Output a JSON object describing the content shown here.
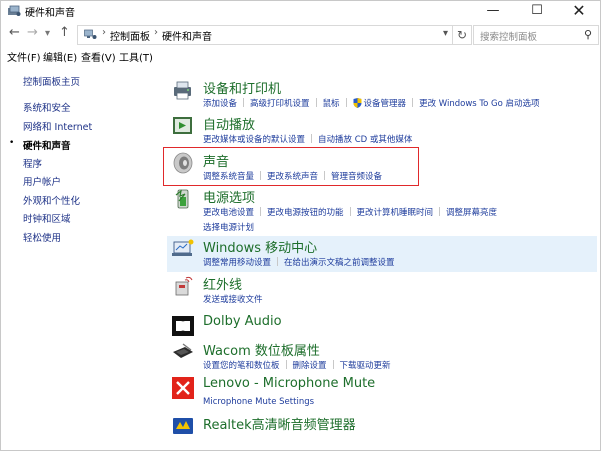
{
  "window": {
    "title": "硬件和声音",
    "minimize": "—",
    "maximize": "☐",
    "close": "✕"
  },
  "nav": {
    "back": "←",
    "forward": "→",
    "dropdown": "▾",
    "up": "↑",
    "breadcrumbs": [
      "控制面板",
      "硬件和声音"
    ],
    "refresh": "↻",
    "search_placeholder": "搜索控制面板"
  },
  "menu": [
    "文件(F)",
    "编辑(E)",
    "查看(V)",
    "工具(T)"
  ],
  "sidebar": {
    "items": [
      {
        "label": "控制面板主页"
      },
      {
        "label": "系统和安全"
      },
      {
        "label": "网络和 Internet"
      },
      {
        "label": "硬件和声音",
        "active": true
      },
      {
        "label": "程序"
      },
      {
        "label": "用户帐户"
      },
      {
        "label": "外观和个性化"
      },
      {
        "label": "时钟和区域"
      },
      {
        "label": "轻松使用"
      }
    ],
    "bullet": "•"
  },
  "categories": [
    {
      "title": "设备和打印机",
      "icon": "printer-icon",
      "links": [
        "添加设备",
        "高级打印机设置",
        "鼠标",
        "设备管理器",
        "更改 Windows To Go 启动选项"
      ]
    },
    {
      "title": "自动播放",
      "icon": "autoplay-icon",
      "links": [
        "更改媒体或设备的默认设置",
        "自动播放 CD 或其他媒体"
      ]
    },
    {
      "title": "声音",
      "icon": "speaker-icon",
      "links": [
        "调整系统音量",
        "更改系统声音",
        "管理音频设备"
      ]
    },
    {
      "title": "电源选项",
      "icon": "power-icon",
      "links": [
        "更改电池设置",
        "更改电源按钮的功能",
        "更改计算机睡眠时间",
        "调整屏幕亮度",
        "选择电源计划"
      ]
    },
    {
      "title": "Windows 移动中心",
      "icon": "mobility-center-icon",
      "links": [
        "调整常用移动设置",
        "在给出演示文稿之前调整设置"
      ]
    },
    {
      "title": "红外线",
      "icon": "infrared-icon",
      "links": [
        "发送或接收文件"
      ]
    },
    {
      "title": "Dolby Audio",
      "icon": "dolby-icon",
      "links": []
    },
    {
      "title": "Wacom 数位板属性",
      "icon": "wacom-tablet-icon",
      "links": [
        "设置您的笔和数位板",
        "删除设置",
        "下载驱动更新"
      ]
    },
    {
      "title": "Lenovo - Microphone Mute",
      "icon": "microphone-mute-icon",
      "links": [
        "Microphone Mute Settings"
      ]
    },
    {
      "title": "Realtek高清晰音频管理器",
      "icon": "realtek-audio-icon",
      "links": []
    }
  ],
  "colors": {
    "category_title": "#1d6e2b",
    "link": "#1e3c9c",
    "sidebar_link": "#1e3287",
    "highlight_border": "#e0292b",
    "hover_background": "#e5f1fb"
  }
}
